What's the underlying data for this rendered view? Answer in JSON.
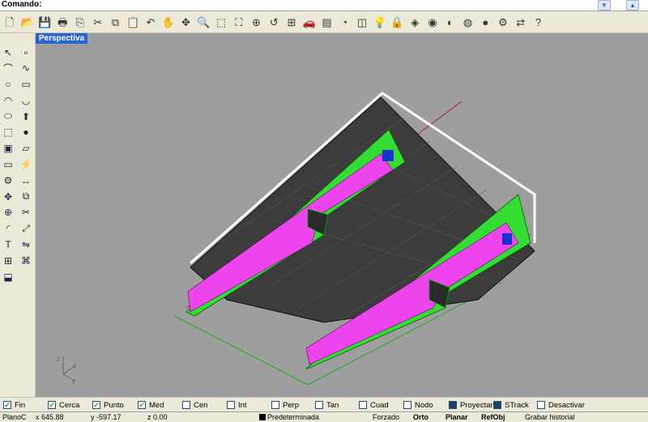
{
  "command": {
    "label": "Comando:",
    "value": ""
  },
  "toolbar": {
    "icons": [
      "new-icon",
      "open-icon",
      "save-icon",
      "print-icon",
      "import-icon",
      "cut-icon",
      "copy-icon",
      "paste-icon",
      "undo-icon",
      "pan-icon",
      "rotate-view-icon",
      "zoom-icon",
      "zoom-window-icon",
      "zoom-extents-icon",
      "zoom-selected-icon",
      "undo-view-icon",
      "four-viewports-icon",
      "car-icon",
      "named-views-icon",
      "camera-icon",
      "cplane-icon",
      "bulb-icon",
      "lock-icon",
      "layer-icon",
      "color-wheel-icon",
      "shade-icon",
      "sphere-render-icon",
      "render-icon",
      "options-icon",
      "history-icon",
      "help-icon"
    ]
  },
  "viewport": {
    "tab_label": "Perspectiva",
    "background": "#9e9e9e"
  },
  "osnaps": [
    {
      "label": "Fin",
      "checked": true
    },
    {
      "label": "Cerca",
      "checked": true
    },
    {
      "label": "Punto",
      "checked": true
    },
    {
      "label": "Med",
      "checked": true
    },
    {
      "label": "Cen",
      "checked": false
    },
    {
      "label": "Int",
      "checked": false
    },
    {
      "label": "Perp",
      "checked": false
    },
    {
      "label": "Tan",
      "checked": false
    },
    {
      "label": "Cuad",
      "checked": false
    },
    {
      "label": "Nodo",
      "checked": false
    },
    {
      "label": "Proyectar",
      "checked": "filled"
    },
    {
      "label": "STrack",
      "checked": "filled"
    },
    {
      "label": "Desactivar",
      "checked": false
    }
  ],
  "status": {
    "cplane": "PlanoC",
    "x": "x 645.88",
    "y": "y -597.17",
    "z": "z 0.00",
    "layer": "Predeterminada",
    "forzado": "Forzado",
    "orto": "Orto",
    "planar": "Planar",
    "refobj": "RefObj",
    "history": "Grabar historial"
  },
  "colors": {
    "accent": "#2a63d4",
    "green": "#33dd33",
    "magenta": "#ee44ee",
    "hull": "#3a3a3a"
  }
}
